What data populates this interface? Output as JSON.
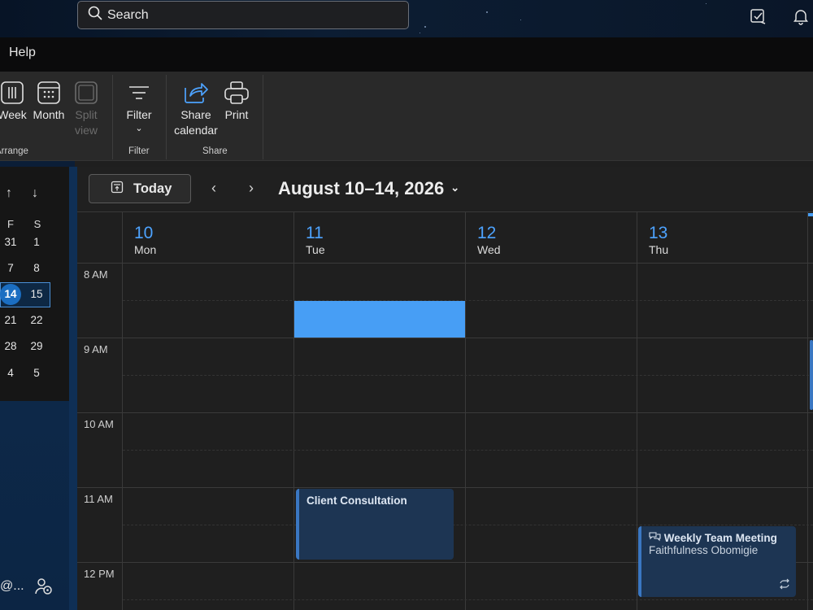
{
  "topbar": {
    "search_label": "Search",
    "icons": [
      "todo-icon",
      "bell-icon"
    ]
  },
  "menu": {
    "help": "Help"
  },
  "ribbon": {
    "week": "Week",
    "month": "Month",
    "split_view": "Split view",
    "arrange_group": "Arrange",
    "filter": "Filter",
    "filter_group": "Filter",
    "share_calendar": "Share calendar",
    "print": "Print",
    "share_group": "Share"
  },
  "mini_calendar": {
    "dow": [
      "F",
      "S"
    ],
    "rows": [
      [
        "31",
        "1"
      ],
      [
        "7",
        "8"
      ],
      [
        "14",
        "15"
      ],
      [
        "21",
        "22"
      ],
      [
        "28",
        "29"
      ],
      [
        "4",
        "5"
      ]
    ],
    "today": "14"
  },
  "left_bottom": {
    "account_text": "@..."
  },
  "calendar": {
    "today_label": "Today",
    "range_label": "August 10–14, 2026",
    "days": [
      {
        "num": "10",
        "dow": "Mon"
      },
      {
        "num": "11",
        "dow": "Tue"
      },
      {
        "num": "12",
        "dow": "Wed"
      },
      {
        "num": "13",
        "dow": "Thu"
      }
    ],
    "times": [
      "8 AM",
      "9 AM",
      "10 AM",
      "11 AM",
      "12 PM"
    ],
    "events": [
      {
        "title": "Client Consultation",
        "day": "Tue",
        "start": "11:00 AM",
        "end": "12:00 PM"
      },
      {
        "title": "Weekly Team Meeting",
        "organizer": "Faithfulness Obomigie",
        "day": "Thu",
        "start": "11:30 AM",
        "end": "12:30 PM",
        "recurring": true
      }
    ]
  },
  "colors": {
    "accent": "#479ef5",
    "day_number": "#4da3ff",
    "event_bg": "#1d3553"
  }
}
